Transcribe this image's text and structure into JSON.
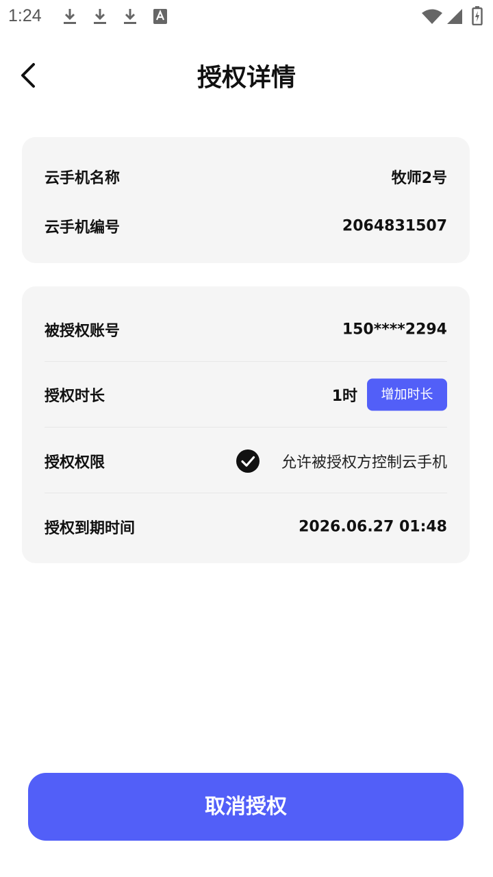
{
  "status_bar": {
    "time": "1:24",
    "left_icons": [
      "download-icon",
      "download-icon",
      "download-icon",
      "font-a-icon"
    ],
    "right_icons": [
      "wifi-icon",
      "signal-icon",
      "battery-icon"
    ]
  },
  "header": {
    "title": "授权详情",
    "back_icon": "chevron-left-icon"
  },
  "device_card": {
    "name_label": "云手机名称",
    "name_value": "牧师2号",
    "id_label": "云手机编号",
    "id_value": "2064831507"
  },
  "auth_card": {
    "account_label": "被授权账号",
    "account_value": "150****2294",
    "duration_label": "授权时长",
    "duration_value": "1时",
    "add_duration_button": "增加时长",
    "permission_label": "授权权限",
    "permission_value": "允许被授权方控制云手机",
    "permission_checked": true,
    "expiry_label": "授权到期时间",
    "expiry_value": "2026.06.27 01:48"
  },
  "footer": {
    "cancel_button": "取消授权"
  },
  "colors": {
    "accent": "#525ff8",
    "card_bg": "#f5f5f5"
  }
}
